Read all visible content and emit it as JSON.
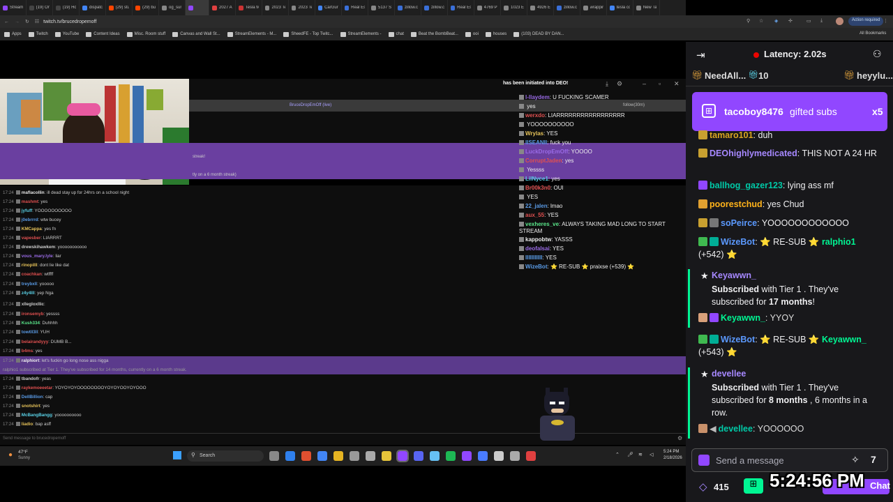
{
  "browser": {
    "tabs": [
      "Stream",
      "(19) On",
      "(19) Ho",
      "dispatc",
      "(29) stu",
      "(29) bu",
      "og_sur",
      "",
      "2027 A",
      "Tesla M",
      "2023 Te",
      "2023 Te",
      "CarGuru",
      "Real Est",
      "5137 S",
      "zillow.c",
      "zillow.c",
      "Real Est",
      "4769 Pl",
      "1023 E",
      "4926 E",
      "zillow.c",
      "wrappin",
      "tesla co",
      "New Ta"
    ],
    "gemini": "Gemini",
    "url": "twitch.tv/brucedropemoff",
    "action_required": "Action required",
    "bookmarks": [
      "Apps",
      "Twitch",
      "YouTube",
      "Content Ideas",
      "Misc. Room stuff",
      "Canvas and Wall St...",
      "StreamElements - M...",
      "SheedFE - Top Twitc...",
      "StreamElements -",
      "chat",
      "Beat the BombBeat...",
      "ooi",
      "houses",
      "(103) DEAD BY DAN..."
    ],
    "all_bookmarks": "All Bookmarks"
  },
  "popout": {
    "title": "BruceDropEmOff (live)",
    "follow": "follow(30m)",
    "header": "has been initiated into DEO!",
    "banner1": "streak!",
    "banner2": "tly on a 6 month streak)",
    "input_placeholder": "Send message to brucedropemoff"
  },
  "popout_chat": [
    {
      "t": "17:24",
      "u": "maflacollin",
      "m": "ill dead stay up for 24hrs on a school night",
      "c": "#e6e6e6"
    },
    {
      "t": "17:24",
      "u": "mashmt",
      "m": "yes",
      "c": "#e05050"
    },
    {
      "t": "17:24",
      "u": "jyfuff",
      "m": "YOOOOOOOOOO",
      "c": "#5ad1e6"
    },
    {
      "t": "17:24",
      "u": "j0ebrrrd",
      "m": "wtw bucey",
      "c": "#5a9be6"
    },
    {
      "t": "17:24",
      "u": "KMCappa",
      "m": "yes fn",
      "c": "#e6c35a"
    },
    {
      "t": "17:24",
      "u": "vapesber",
      "m": "LIARRRT",
      "c": "#e05050"
    },
    {
      "t": "17:24",
      "u": "drewskihawkem",
      "m": "yooooooooooo",
      "c": "#ccc"
    },
    {
      "t": "17:24",
      "u": "vous_mary.lyle",
      "m": "liar",
      "c": "#9a6be6"
    },
    {
      "t": "17:24",
      "u": "rinopilll",
      "m": "dont lie like dat",
      "c": "#e6c35a"
    },
    {
      "t": "17:24",
      "u": "coachkan",
      "m": "wtffff",
      "c": "#e05050"
    },
    {
      "t": "17:24",
      "u": "treybxll",
      "m": "yooooo",
      "c": "#5a9be6"
    },
    {
      "t": "17:24",
      "u": "z4y4lll",
      "m": "yep Nga",
      "c": "#5ad1e6"
    },
    {
      "t": "17:24",
      "u": "xllegloxllic",
      "m": "",
      "c": "#ccc"
    },
    {
      "t": "17:24",
      "u": "ironsemyb",
      "m": "yessss",
      "c": "#e05050"
    },
    {
      "t": "17:24",
      "u": "Kush334",
      "m": "Duhhhh",
      "c": "#5ae68a"
    },
    {
      "t": "17:24",
      "u": "towtll3ll",
      "m": "YUH",
      "c": "#5a9be6"
    },
    {
      "t": "17:24",
      "u": "belairandyyy",
      "m": "DUMB B...",
      "c": "#e05050"
    },
    {
      "t": "17:24",
      "u": "b4ms",
      "m": "yes",
      "c": "#e05050"
    },
    {
      "t": "17:24",
      "u": "ralphiort",
      "m": "let's fuckin go long nose ass nigga",
      "c": "#eee"
    },
    {
      "t": "",
      "u": "",
      "m": "ralphio1 subscribed at Tier 1. They've subscribed for 14 months, currently on a 6 month streak.",
      "c": "#bbb"
    },
    {
      "t": "17:24",
      "u": "tbandofr",
      "m": "yeas",
      "c": "#ccc"
    },
    {
      "t": "17:24",
      "u": "raykemoeeetar",
      "m": "YOYOYOYOOOOOOOOYOYOYOOYOYOOO",
      "c": "#e05050"
    },
    {
      "t": "17:24",
      "u": "DellBillion",
      "m": "cap",
      "c": "#5a9be6"
    },
    {
      "t": "17:24",
      "u": "snotshirt",
      "m": "yes",
      "c": "#e6c35a"
    },
    {
      "t": "17:24",
      "u": "McBangBangg",
      "m": "yoooooooooo",
      "c": "#5ad1e6"
    },
    {
      "t": "17:24",
      "u": "liadio",
      "m": "bap asff",
      "c": "#e6c35a"
    }
  ],
  "overlay_chat": [
    {
      "u": "l-llaydem",
      "m": "U FUCKING SCAMER",
      "c": "#9a6be6"
    },
    {
      "u": "",
      "m": "yes",
      "c": "#5ae68a"
    },
    {
      "u": "werxdo",
      "m": "LIARRRRRRRRRRRRRRRRR",
      "c": "#e05050"
    },
    {
      "u": "",
      "m": "YOOOOOOOOOO",
      "c": "#5a9be6"
    },
    {
      "u": "Wrylas",
      "m": "YES",
      "c": "#e6c35a"
    },
    {
      "u": "IISEANII",
      "m": "fuck you",
      "c": "#5a9be6"
    },
    {
      "u": "LuckDropEmOff",
      "m": "YOOOO",
      "c": "#9a6be6"
    },
    {
      "u": "CorruptJaden",
      "m": "yes",
      "c": "#e05050"
    },
    {
      "u": "",
      "m": "Yessss",
      "c": "#5ae68a"
    },
    {
      "u": "LilNyce1",
      "m": "yes",
      "c": "#5ad1e6"
    },
    {
      "u": "Br00k3n0",
      "m": "OUI",
      "c": "#e05050"
    },
    {
      "u": "",
      "m": "YES",
      "c": "#e05050"
    },
    {
      "u": "22_jalen",
      "m": "lmao",
      "c": "#5a9be6"
    },
    {
      "u": "aux_55",
      "m": "YES",
      "c": "#e05050"
    },
    {
      "u": "vexheres_ve",
      "m": "ALWAYS TAKING MAD LONG TO START STREAM",
      "c": "#5ae68a"
    },
    {
      "u": "kappobtw",
      "m": "YASSS",
      "c": "#eee"
    },
    {
      "u": "deofalsai",
      "m": "YES",
      "c": "#9a6be6"
    },
    {
      "u": "IIIIIIIIIII",
      "m": "YES",
      "c": "#5a9be6"
    },
    {
      "u": "WizeBot",
      "m": "⭐ RE-SUB ⭐ praixse (+539) ⭐",
      "c": "#5a9be6"
    }
  ],
  "taskbar": {
    "weather_temp": "47°F",
    "weather_cond": "Sunny",
    "search": "Search",
    "time": "5:24 PM",
    "date": "2/18/2026"
  },
  "sidebar": {
    "latency": "Latency: 2.02s",
    "gift1_user": "NeedAll...",
    "gift1_count": "10",
    "gift2_user": "heyylu...",
    "gifted_user": "tacoboy8476",
    "gifted_text": "gifted subs",
    "gifted_count": "x5",
    "colors": {
      "purple": "#9147ff",
      "bg": "#18181b"
    },
    "messages": [
      {
        "u": "tamaro101",
        "m": ": duh",
        "c": "#daa520"
      },
      {
        "u": "DEOhighlymedicated",
        "m": ": THIS NOT A 24 HR",
        "c": "#a688ff"
      },
      {
        "u": "ballhog_gazer123",
        "m": ": lying ass mf",
        "c": "#00c9a7"
      },
      {
        "u": "poorestchud",
        "m": ": yes Chud",
        "c": "#ffb31a"
      },
      {
        "u": "soPeirce",
        "m": ": YOOOOOOOOOOOO",
        "c": "#5b99ff"
      },
      {
        "u": "WizeBot",
        "m": ": ⭐ RE-SUB ⭐ ",
        "c": "#5b99ff",
        "x": "ralphio1",
        "xc": "#00f593",
        "tail": "(+542) ⭐"
      }
    ],
    "sub1": {
      "user": "Keyawwn_",
      "l1": "Subscribed",
      "l2": " with Tier 1 . They've",
      "l3": "subscribed for ",
      "l4": "17 months",
      "l5": "!"
    },
    "keyawwn_msg": {
      "u": "Keyawwn_",
      "m": ": YYOY"
    },
    "wize2": {
      "u": "WizeBot",
      "m": ": ⭐ RE-SUB ⭐ ",
      "x": "Keyawwn_",
      "tail": "(+543) ⭐"
    },
    "sub2": {
      "user": "devellee",
      "l1": "Subscribed",
      "l2": " with Tier 1 . They've",
      "l3": "subscribed for ",
      "l4": "8 months",
      "l5": " , 6 months in a",
      "l6": "row."
    },
    "devellee_msg": {
      "u": "devellee",
      "m": ": YOOOOOO"
    },
    "send_placeholder": "Send a message",
    "points": "415",
    "chat_button": "Chat",
    "clock": "5:24:56 PM"
  }
}
